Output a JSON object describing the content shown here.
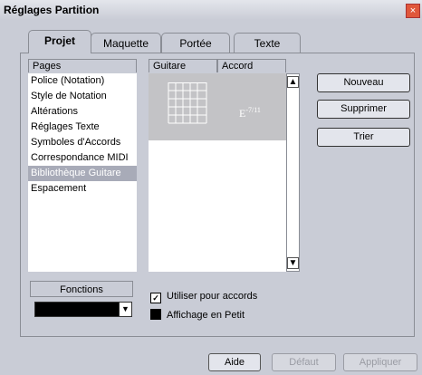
{
  "window": {
    "title": "Réglages Partition",
    "close_glyph": "×"
  },
  "tabs": [
    {
      "label": "Projet",
      "active": true
    },
    {
      "label": "Maquette",
      "active": false
    },
    {
      "label": "Portée",
      "active": false
    },
    {
      "label": "Texte",
      "active": false
    }
  ],
  "pages": {
    "header": "Pages",
    "items": [
      "Police (Notation)",
      "Style de Notation",
      "Altérations",
      "Réglages Texte",
      "Symboles d'Accords",
      "Correspondance MIDI",
      "Bibliothèque Guitare",
      "Espacement"
    ],
    "selected_index": 6
  },
  "library": {
    "headers": {
      "guitar": "Guitare",
      "chord": "Accord"
    },
    "rows": [
      {
        "chord": "E-7/11"
      }
    ],
    "chord_root": "E",
    "chord_suffix": "-7/11"
  },
  "side_buttons": {
    "new": "Nouveau",
    "delete": "Supprimer",
    "sort": "Trier"
  },
  "fonctions": {
    "label": "Fonctions",
    "value": ""
  },
  "options": {
    "use_for_chords": {
      "label": "Utiliser pour accords",
      "checked": true
    },
    "small_display": {
      "label": "Affichage en Petit",
      "checked": false
    }
  },
  "bottom_buttons": {
    "help": "Aide",
    "default": "Défaut",
    "apply": "Appliquer"
  },
  "icons": {
    "scroll_up": "up-arrow-icon",
    "scroll_down": "down-arrow-icon",
    "dropdown": "dropdown-arrow-icon"
  }
}
